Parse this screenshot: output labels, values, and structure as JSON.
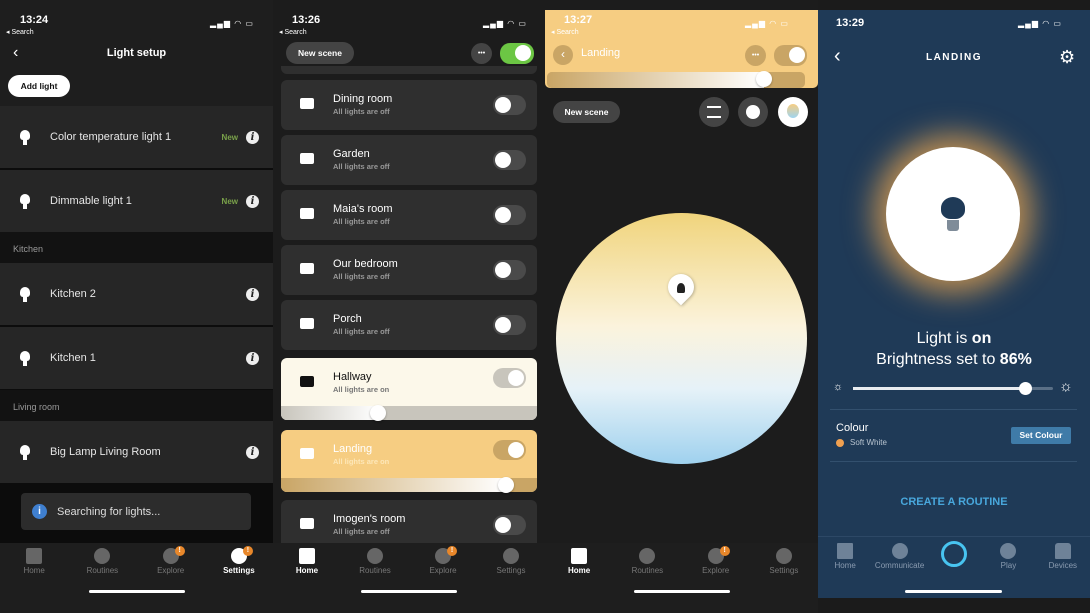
{
  "panel1": {
    "status": {
      "time": "13:24",
      "back": "◂ Search"
    },
    "title": "Light setup",
    "add_light": "Add light",
    "lights": [
      {
        "name": "Color temperature light 1",
        "badge": "New"
      },
      {
        "name": "Dimmable light 1",
        "badge": "New"
      }
    ],
    "sections": [
      {
        "title": "Kitchen",
        "lights": [
          "Kitchen 2",
          "Kitchen 1"
        ]
      },
      {
        "title": "Living room",
        "lights": [
          "Big Lamp Living Room"
        ]
      }
    ],
    "toast": "Searching for lights...",
    "tabs": [
      {
        "label": "Home"
      },
      {
        "label": "Routines"
      },
      {
        "label": "Explore",
        "badge": "!"
      },
      {
        "label": "Settings",
        "badge": "!",
        "active": true
      }
    ]
  },
  "panel2": {
    "status": {
      "time": "13:26",
      "back": "◂ Search"
    },
    "new_scene": "New scene",
    "more": "•••",
    "rooms": [
      {
        "name": "Dining room",
        "status": "All lights are off",
        "on": false
      },
      {
        "name": "Garden",
        "status": "All lights are off",
        "on": false
      },
      {
        "name": "Maia's room",
        "status": "All lights are off",
        "on": false
      },
      {
        "name": "Our bedroom",
        "status": "All lights are off",
        "on": false
      },
      {
        "name": "Porch",
        "status": "All lights are off",
        "on": false
      },
      {
        "name": "Hallway",
        "status": "All lights are on",
        "on": true,
        "brightness": 0.38
      },
      {
        "name": "Landing",
        "status": "All lights are on",
        "on": true,
        "brightness": 0.88
      },
      {
        "name": "Imogen's room",
        "status": "All lights are off",
        "on": false
      }
    ],
    "tabs": [
      {
        "label": "Home",
        "active": true
      },
      {
        "label": "Routines"
      },
      {
        "label": "Explore",
        "badge": "!"
      },
      {
        "label": "Settings"
      }
    ]
  },
  "panel3": {
    "status": {
      "time": "13:27",
      "back": "◂ Search"
    },
    "title": "Landing",
    "more": "•••",
    "brightness": 0.84,
    "new_scene": "New scene",
    "tabs": [
      {
        "label": "Home",
        "active": true
      },
      {
        "label": "Routines"
      },
      {
        "label": "Explore",
        "badge": "!"
      },
      {
        "label": "Settings"
      }
    ]
  },
  "panel4": {
    "status": {
      "time": "13:29"
    },
    "title": "LANDING",
    "state_prefix": "Light is ",
    "state": "on",
    "brightness_prefix": "Brightness set to ",
    "brightness": "86%",
    "brightness_value": 86,
    "colour_label": "Colour",
    "colour_value": "Soft White",
    "colour_swatch": "#f0a050",
    "set_colour": "Set Colour",
    "create_routine": "CREATE A ROUTINE",
    "tabs": [
      {
        "label": "Home"
      },
      {
        "label": "Communicate"
      },
      {
        "label": ""
      },
      {
        "label": "Play"
      },
      {
        "label": "Devices"
      }
    ]
  },
  "colors": {
    "hue_green": "#6cc644",
    "hue_yellow": "#f6cd82",
    "alexa_navy": "#1f3a57",
    "alexa_blue": "#48a7dc",
    "badge_orange": "#e8872a"
  }
}
